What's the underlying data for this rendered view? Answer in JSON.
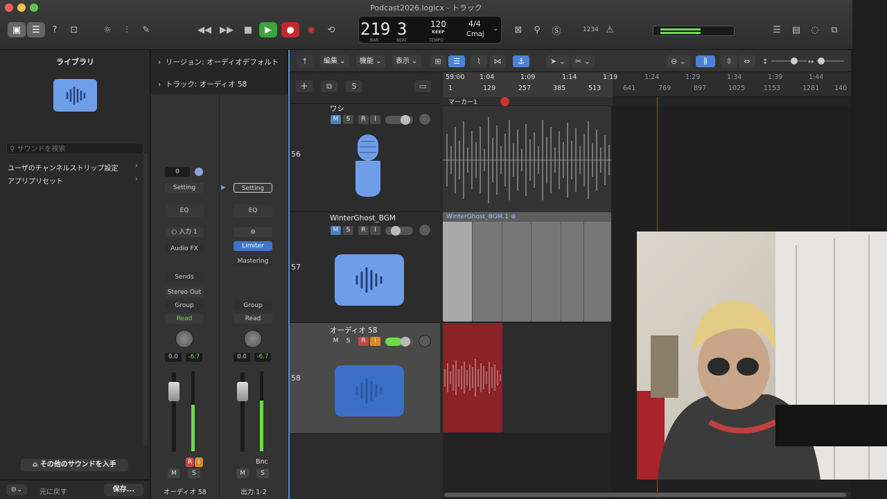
{
  "window": {
    "title": "Podcast2026.logicx - トラック"
  },
  "lcd": {
    "bar": "219",
    "beat": "3",
    "bar_label": "BAR",
    "beat_label": "BEAT",
    "tempo": "120",
    "tempo_label": "TEMPO",
    "keep": "KEEP",
    "signature": "4/4",
    "key": "Cmaj"
  },
  "toolbar": {
    "counter": "1234",
    "colors": {
      "play": "#3aa53a",
      "record": "#c8262c",
      "accent": "#4a83d6"
    }
  },
  "library": {
    "title": "ライブラリ",
    "search_placeholder": "サウンドを検索",
    "items": [
      {
        "label": "ユーザのチャンネルストリップ設定"
      },
      {
        "label": "アプリプリセット"
      }
    ],
    "more_button": "その他のサウンドを入手",
    "revert_button": "元に戻す",
    "save_button": "保存..."
  },
  "inspector": {
    "region_row": "リージョン: オーディオデフォルト",
    "track_row": "トラック: オーディオ 58",
    "strip1": {
      "value": "0",
      "setting": "Setting",
      "eq": "EQ",
      "input": "入力 1",
      "audio_fx": "Audio FX",
      "sends": "Sends",
      "output": "Stereo Out",
      "group": "Group",
      "automation": "Read",
      "vol": "0.0",
      "peak": "-6.7",
      "rec": "R",
      "input_mon": "I",
      "mute": "M",
      "solo": "S",
      "name": "オーディオ 58"
    },
    "strip2": {
      "setting": "Setting",
      "eq": "EQ",
      "plugin": "Limiter",
      "mastering": "Mastering",
      "group": "Group",
      "automation": "Read",
      "vol": "0.0",
      "peak": "-6.7",
      "bnc": "Bnc",
      "mute": "M",
      "solo": "S",
      "name": "出力 1-2"
    },
    "fader_scale": [
      "0",
      "3",
      "6",
      "9",
      "12",
      "15",
      "18",
      "21",
      "24",
      "30",
      "35",
      "40",
      "45",
      "50",
      "60"
    ]
  },
  "tracks_toolbar": {
    "menus": [
      "編集",
      "機能",
      "表示"
    ],
    "header_buttons": {
      "add": "+",
      "s": "S"
    }
  },
  "ruler": {
    "times": [
      "59:00",
      "1:04",
      "1:09",
      "1:14",
      "1:19",
      "1:24",
      "1:29",
      "1:34",
      "1:39",
      "1:44"
    ],
    "bars": [
      "1",
      "129",
      "257",
      "385",
      "513",
      "641",
      "769",
      "897",
      "1025",
      "1153",
      "1281",
      "140"
    ],
    "marker": "マーカー1"
  },
  "tracks": [
    {
      "number": "56",
      "name": "ワシ",
      "icon": "microphone-icon",
      "rec_on": false,
      "input_on": false
    },
    {
      "number": "57",
      "name": "WinterGhost_BGM",
      "icon": "waveform-icon",
      "rec_on": false,
      "input_on": false,
      "region_label": "WinterGhost_BGM.1"
    },
    {
      "number": "58",
      "name": "オーディオ 58",
      "icon": "waveform-icon",
      "rec_on": true,
      "input_on": true
    }
  ],
  "track_buttons": {
    "mute": "M",
    "solo": "S",
    "rec": "R",
    "input": "I"
  }
}
